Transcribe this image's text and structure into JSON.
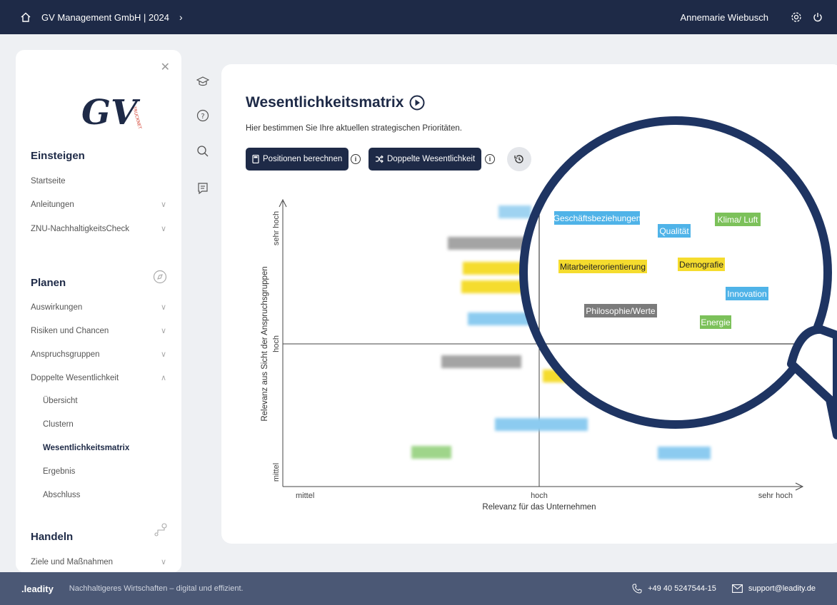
{
  "topbar": {
    "breadcrumb": "GV Management GmbH | 2024",
    "user": "Annemarie Wiebusch",
    "icons": [
      "home-icon",
      "chevron-right-icon",
      "settings-icon",
      "power-icon"
    ]
  },
  "sidebar": {
    "logo_text": "GV",
    "logo_tag": "TRUCKNET",
    "sections": {
      "einsteigen": "Einsteigen",
      "planen": "Planen",
      "handeln": "Handeln"
    },
    "items": {
      "startseite": "Startseite",
      "anleitungen": "Anleitungen",
      "znu": "ZNU-NachhaltigkeitsCheck",
      "auswirkungen": "Auswirkungen",
      "risiken": "Risiken und Chancen",
      "anspruchsgruppen": "Anspruchsgruppen",
      "doppelte": "Doppelte Wesentlichkeit",
      "uebersicht": "Übersicht",
      "clustern": "Clustern",
      "matrix": "Wesentlichkeitsmatrix",
      "ergebnis": "Ergebnis",
      "abschluss": "Abschluss",
      "ziele": "Ziele und Maßnahmen"
    }
  },
  "main": {
    "title": "Wesentlichkeitsmatrix",
    "subtitle": "Hier bestimmen Sie Ihre aktuellen strategischen Prioritäten.",
    "btn_positions": "Positionen berechnen",
    "btn_doppelte": "Doppelte Wesentlichkeit"
  },
  "chart_data": {
    "type": "scatter",
    "xlabel": "Relevanz für das Unternehmen",
    "ylabel": "Relevanz aus Sicht der Anspruchsgruppen",
    "x_ticks": [
      "mittel",
      "hoch",
      "sehr hoch"
    ],
    "y_ticks": [
      "mittel",
      "hoch",
      "sehr hoch"
    ],
    "colors": {
      "blue": "#4fb3e8",
      "green": "#7cc15a",
      "yellow": "#f5dc2e",
      "gray": "#7b7b7b"
    },
    "magnified_points": [
      {
        "label": "Geschäftsbeziehungen",
        "color": "blue"
      },
      {
        "label": "Qualität",
        "color": "blue"
      },
      {
        "label": "Klima/ Luft",
        "color": "green"
      },
      {
        "label": "Mitarbeiterorientierung",
        "color": "yellow"
      },
      {
        "label": "Demografie",
        "color": "yellow"
      },
      {
        "label": "Innovation",
        "color": "blue"
      },
      {
        "label": "Philosophie/Werte",
        "color": "gray"
      },
      {
        "label": "Energie",
        "color": "green"
      }
    ]
  },
  "footer": {
    "brand": ".leadity",
    "tagline": "Nachhaltigeres Wirtschaften – digital und effizient.",
    "phone": "+49 40 5247544-15",
    "email": "support@leadity.de"
  }
}
